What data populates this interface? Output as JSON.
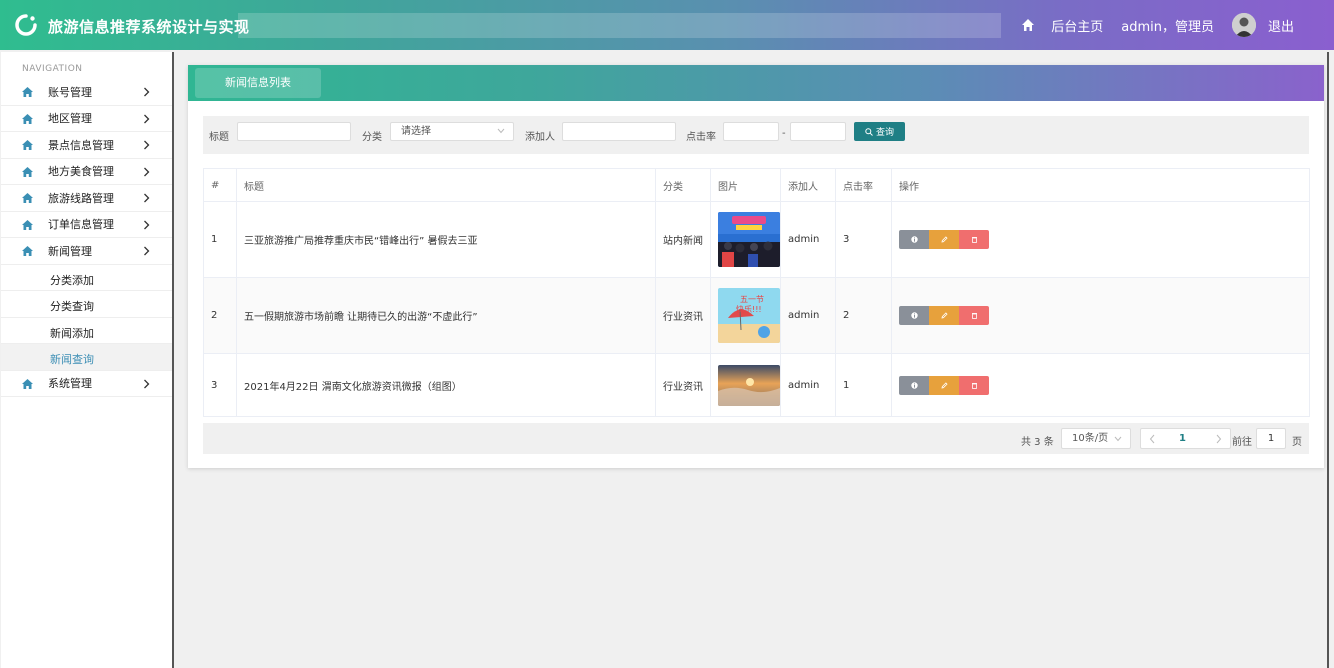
{
  "header": {
    "title": "旅游信息推荐系统设计与实现",
    "home_link": "后台主页",
    "user": "admin，管理员",
    "logout": "退出"
  },
  "sidebar": {
    "caption": "NAVIGATION",
    "items": [
      {
        "label": "账号管理"
      },
      {
        "label": "地区管理"
      },
      {
        "label": "景点信息管理"
      },
      {
        "label": "地方美食管理"
      },
      {
        "label": "旅游线路管理"
      },
      {
        "label": "订单信息管理"
      },
      {
        "label": "新闻管理"
      }
    ],
    "sub_items": [
      {
        "label": "分类添加"
      },
      {
        "label": "分类查询"
      },
      {
        "label": "新闻添加"
      },
      {
        "label": "新闻查询"
      }
    ],
    "last_item": {
      "label": "系统管理"
    }
  },
  "card": {
    "tab_label": "新闻信息列表"
  },
  "search": {
    "title_label": "标题",
    "category_label": "分类",
    "category_placeholder": "请选择",
    "adder_label": "添加人",
    "clicks_label": "点击率",
    "range_sep": "-",
    "query_button": "查询"
  },
  "table": {
    "columns": [
      "#",
      "标题",
      "分类",
      "图片",
      "添加人",
      "点击率",
      "操作"
    ],
    "rows": [
      {
        "index": "1",
        "title": "三亚旅游推广局推荐重庆市民“错峰出行” 暑假去三亚",
        "category": "站内新闻",
        "image": "crowd-event-photo",
        "adder": "admin",
        "clicks": "3"
      },
      {
        "index": "2",
        "title": "五一假期旅游市场前瞻 让期待已久的出游“不虚此行”",
        "category": "行业资讯",
        "image": "beach-holiday-poster",
        "adder": "admin",
        "clicks": "2"
      },
      {
        "index": "3",
        "title": "2021年4月22日 渭南文化旅游资讯微报（组图）",
        "category": "行业资讯",
        "image": "sunset-sea-of-clouds",
        "adder": "admin",
        "clicks": "1"
      }
    ]
  },
  "pagination": {
    "total": "共 3 条",
    "page_size": "10条/页",
    "current_page": "1",
    "goto_label": "前往",
    "goto_value": "1",
    "page_suffix": "页"
  },
  "colors": {
    "accent": "#1f7f85",
    "edit": "#e7a13c",
    "delete": "#f06e6e",
    "info": "#8a9099"
  }
}
